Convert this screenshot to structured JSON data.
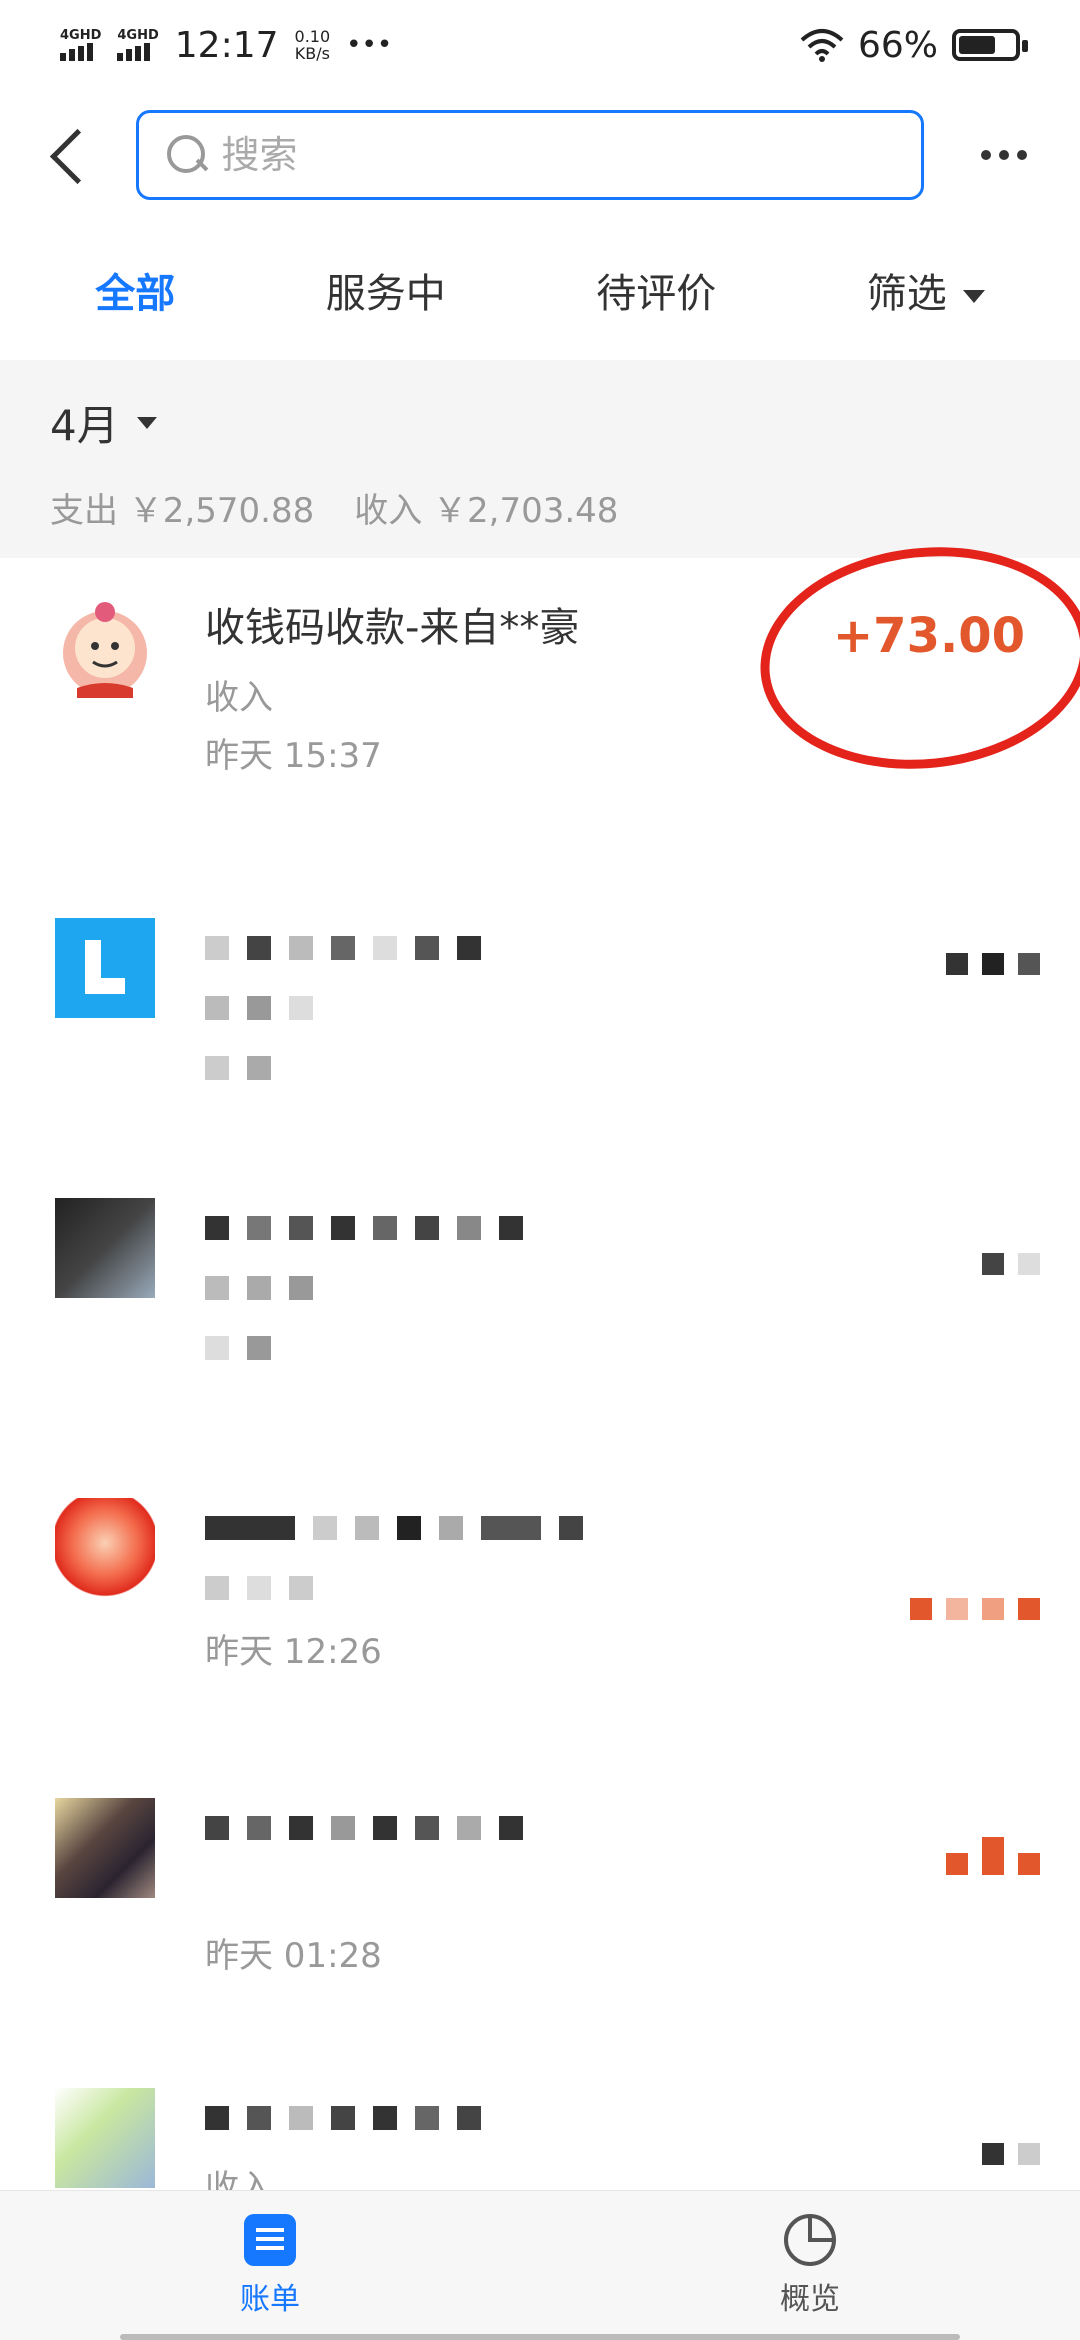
{
  "status_bar": {
    "network1": "4GHD",
    "network2": "4GHD",
    "time": "12:17",
    "speed_value": "0.10",
    "speed_unit": "KB/s",
    "dots": "•••",
    "battery": "66%"
  },
  "search": {
    "placeholder": "搜索"
  },
  "tabs": [
    {
      "label": "全部",
      "active": true
    },
    {
      "label": "服务中",
      "active": false
    },
    {
      "label": "待评价",
      "active": false
    },
    {
      "label": "筛选",
      "active": false
    }
  ],
  "month": {
    "label": "4月",
    "expense": "支出 ￥2,570.88",
    "income": "收入 ￥2,703.48"
  },
  "transactions": [
    {
      "title": "收钱码收款-来自**豪",
      "type": "收入",
      "time": "昨天  15:37",
      "amount": "+73.00"
    },
    {
      "title": "",
      "type": "",
      "time": "",
      "amount": ""
    },
    {
      "title": "",
      "type": "",
      "time": "",
      "amount": ""
    },
    {
      "title": "",
      "type": "",
      "time": "昨天  12:26",
      "amount": ""
    },
    {
      "title": "",
      "type": "",
      "time": "昨天  01:28",
      "amount": ""
    },
    {
      "title": "",
      "type": "收入",
      "time": "",
      "amount": ""
    }
  ],
  "bottom_nav": {
    "bill_label": "账单",
    "overview_label": "概览"
  },
  "colors": {
    "accent": "#1677ff",
    "amount": "#e2572b",
    "annotation_circle": "#e4231b"
  }
}
